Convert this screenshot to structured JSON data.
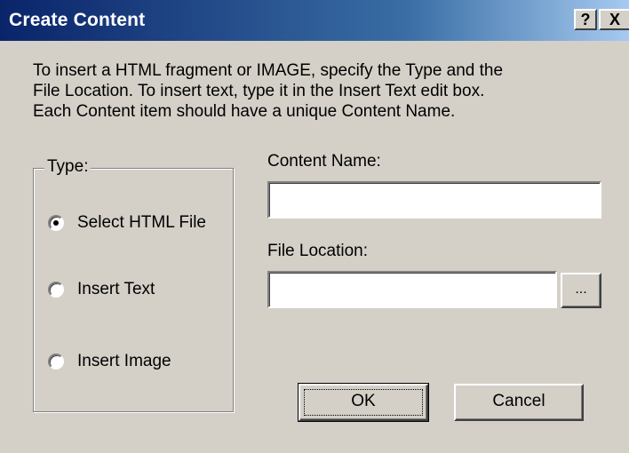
{
  "window": {
    "title": "Create Content",
    "help_button": "?",
    "close_button": "X"
  },
  "instructions": [
    "To insert a HTML fragment or IMAGE, specify the Type and the",
    "File Location. To insert text, type it in the Insert Text edit box.",
    "Each Content item should have a unique Content Name."
  ],
  "type_group": {
    "legend": "Type:",
    "options": [
      {
        "label": "Select HTML File",
        "checked": true
      },
      {
        "label": "Insert Text",
        "checked": false
      },
      {
        "label": "Insert Image",
        "checked": false
      }
    ]
  },
  "content_name": {
    "label": "Content Name:",
    "value": ""
  },
  "file_location": {
    "label": "File Location:",
    "value": "",
    "browse_label": "..."
  },
  "buttons": {
    "ok": "OK",
    "cancel": "Cancel"
  }
}
